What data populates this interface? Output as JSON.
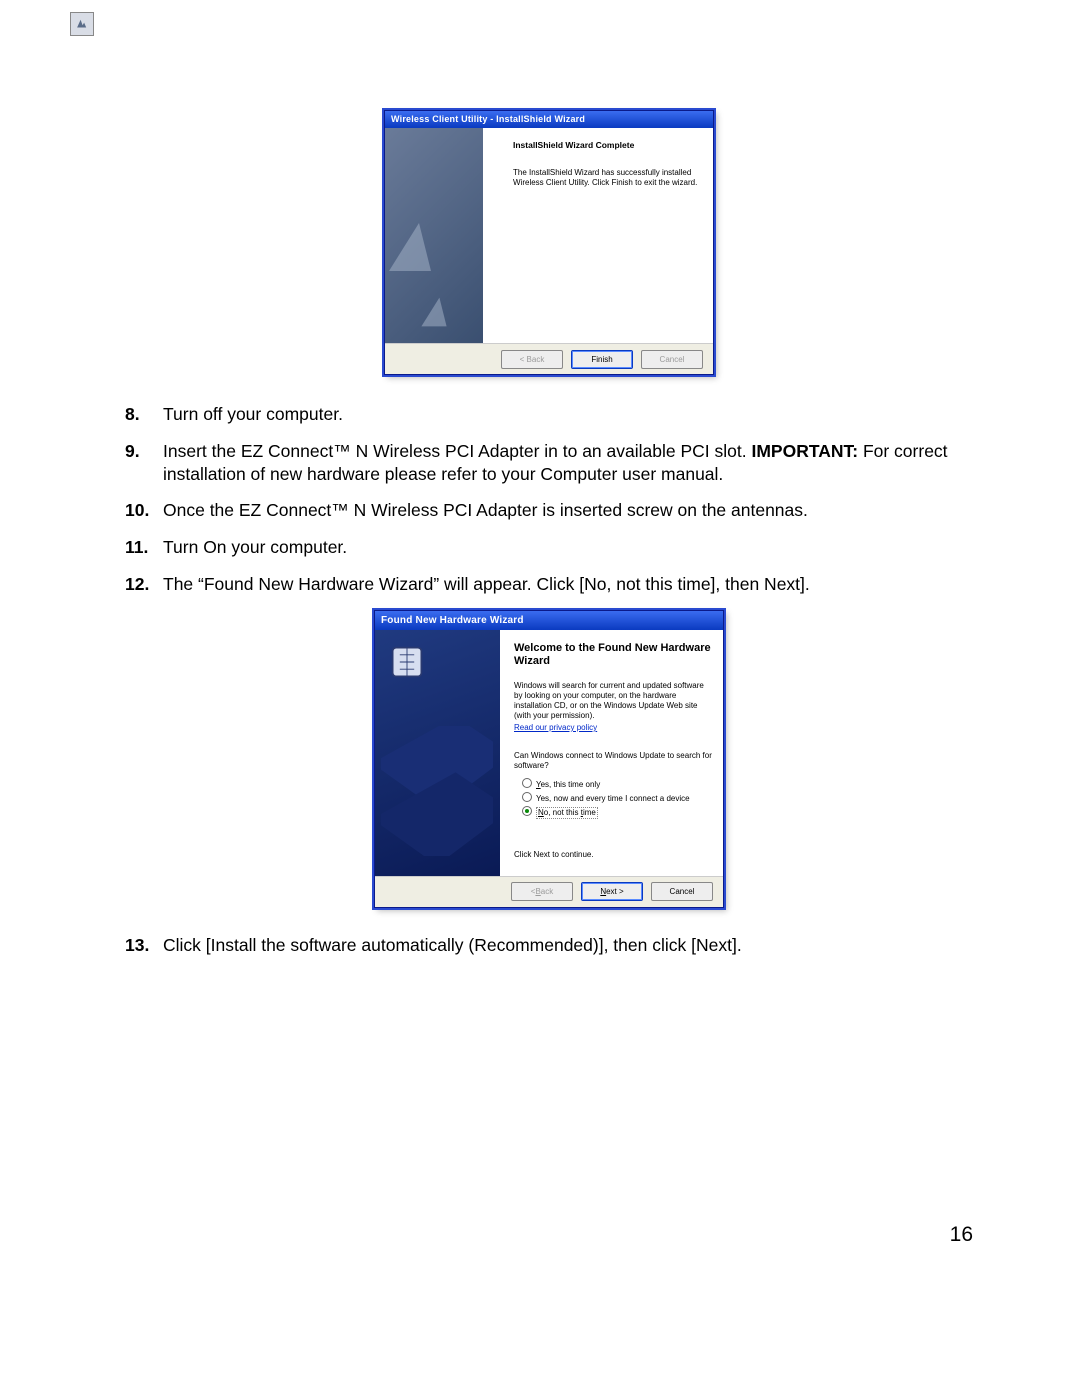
{
  "installshield": {
    "title": "Wireless Client Utility - InstallShield Wizard",
    "heading": "InstallShield Wizard Complete",
    "body": "The InstallShield Wizard has successfully installed Wireless Client Utility. Click Finish to exit the wizard.",
    "btn_back": "< Back",
    "btn_finish": "Finish",
    "btn_cancel": "Cancel"
  },
  "steps": {
    "n8": "8.",
    "t8": "Turn off your computer.",
    "n9": "9.",
    "t9a": "Insert the EZ Connect™ N Wireless PCI Adapter in to an available PCI slot. ",
    "t9b": "IMPORTANT:",
    "t9c": " For correct installation of new hardware please refer to your Computer user manual.",
    "n10": "10.",
    "t10": "Once the EZ Connect™ N Wireless PCI Adapter is inserted screw on the antennas.",
    "n11": "11.",
    "t11": "Turn On your computer.",
    "n12": "12.",
    "t12": "The “Found New Hardware Wizard” will appear. Click [No, not this time], then Next].",
    "n13": "13.",
    "t13": "Click [Install the software automatically (Recommended)], then click [Next]."
  },
  "fnhw": {
    "title": "Found New Hardware Wizard",
    "heading": "Welcome to the Found New Hardware Wizard",
    "desc": "Windows will search for current and updated software by looking on your computer, on the hardware installation CD, or on the Windows Update Web site (with your permission).",
    "privacy": "Read our privacy policy",
    "question": "Can Windows connect to Windows Update to search for software?",
    "opt1_y": "Y",
    "opt1_rest": "es, this time only",
    "opt2": "Yes, now and every time I connect a device",
    "opt3_n": "N",
    "opt3_mid": "o, not this ",
    "opt3_t": "t",
    "opt3_end": "ime",
    "cont": "Click Next to continue.",
    "btn_back_b": "B",
    "btn_back_rest": "ack",
    "btn_next_n": "N",
    "btn_next_rest": "ext >",
    "btn_cancel": "Cancel"
  },
  "page_number": "16"
}
